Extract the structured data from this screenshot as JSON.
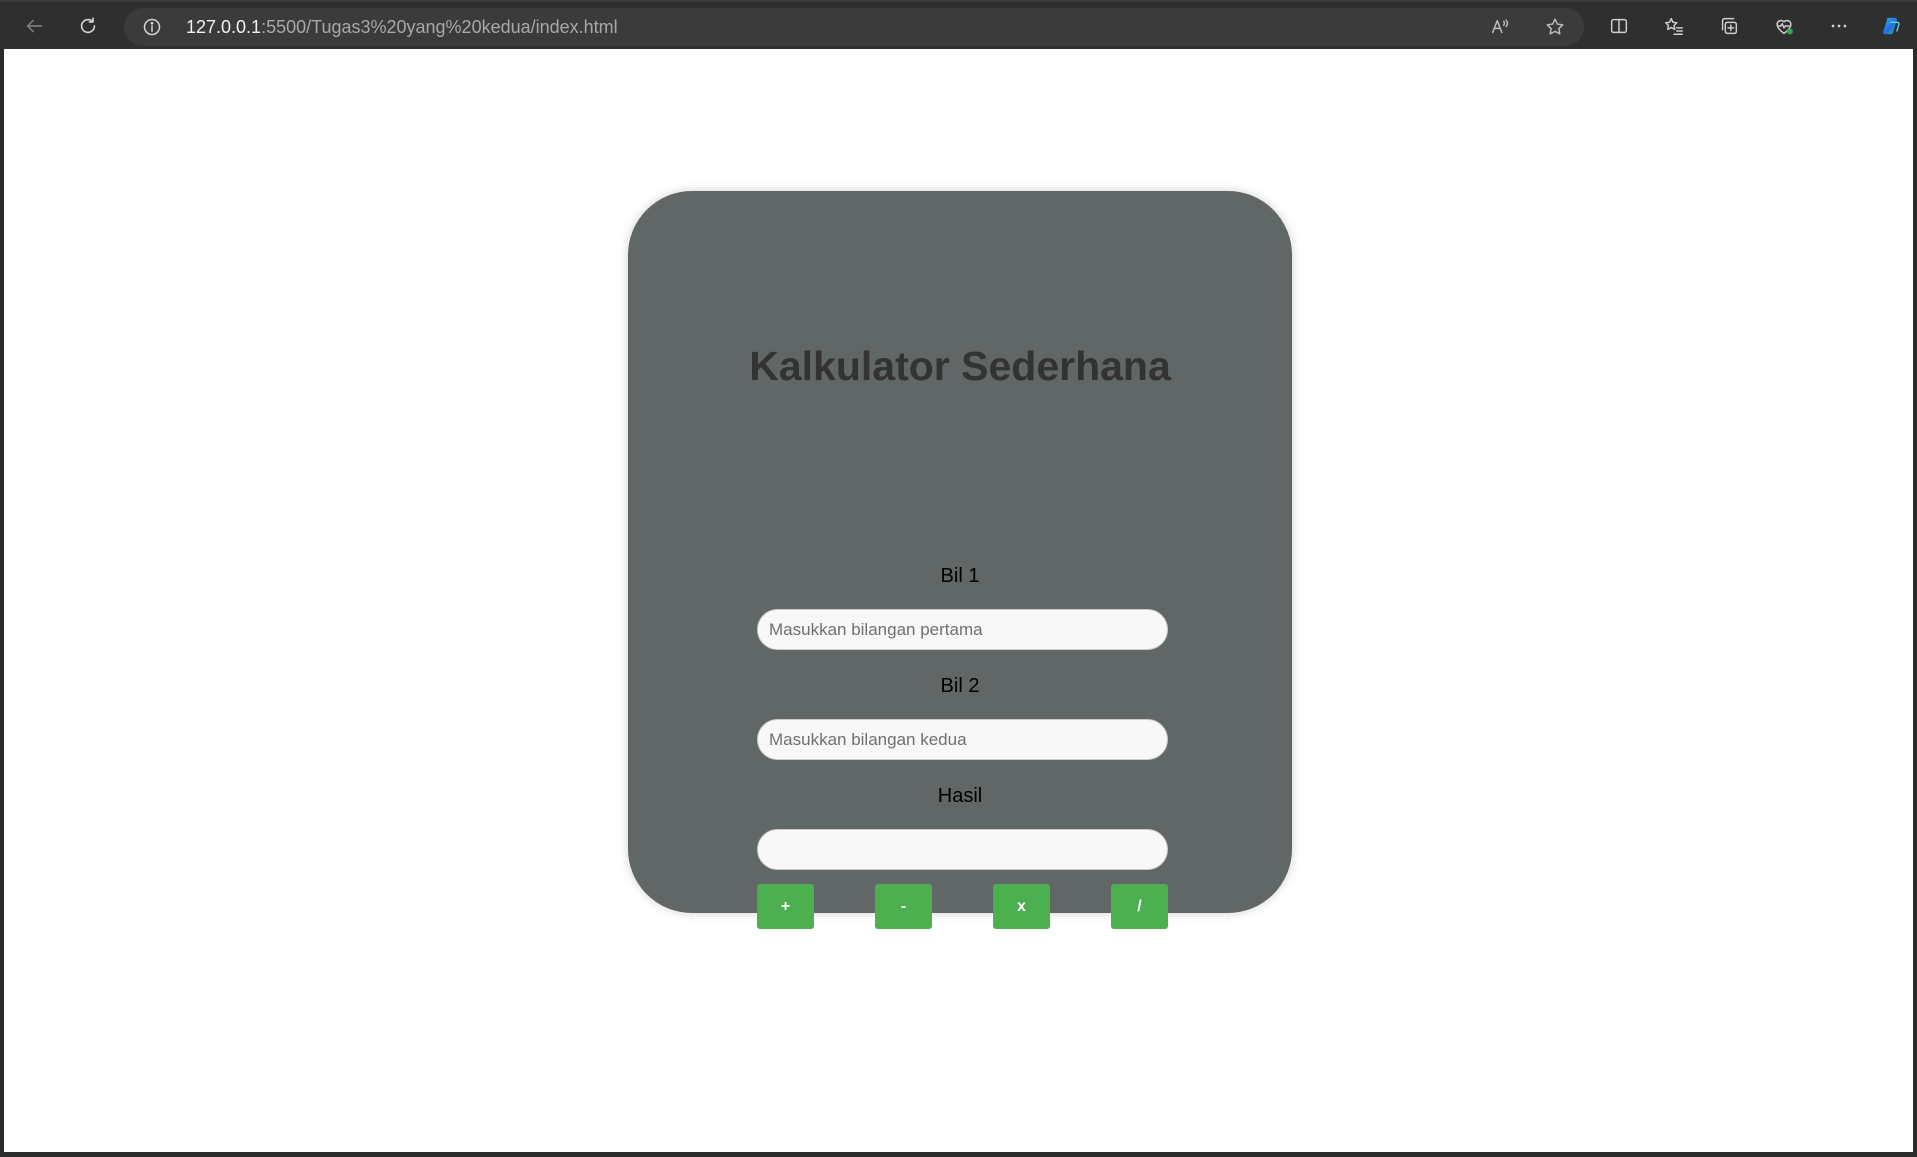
{
  "browser": {
    "url_host": "127.0.0.1",
    "url_rest": ":5500/Tugas3%20yang%20kedua/index.html",
    "icons": {
      "back": "back-arrow-icon",
      "refresh": "refresh-icon",
      "info": "info-icon",
      "read_aloud": "read-aloud-icon",
      "favorite": "star-icon",
      "split_screen": "split-screen-icon",
      "favorites": "favorites-list-icon",
      "collections": "collections-icon",
      "browser_essentials": "heart-pulse-icon",
      "more": "more-dots-icon",
      "copilot": "copilot-icon"
    }
  },
  "calculator": {
    "title": "Kalkulator Sederhana",
    "bil1_label": "Bil 1",
    "bil1_placeholder": "Masukkan bilangan pertama",
    "bil1_value": "",
    "bil2_label": "Bil 2",
    "bil2_placeholder": "Masukkan bilangan kedua",
    "bil2_value": "",
    "hasil_label": "Hasil",
    "hasil_value": "",
    "buttons": {
      "add": "+",
      "subtract": "-",
      "multiply": "x",
      "divide": "/"
    }
  },
  "colors": {
    "card_background": "#606766",
    "title": "#333333",
    "button": "#4caf50",
    "button_text": "#ffffff",
    "input_background": "#f8f8f8"
  }
}
